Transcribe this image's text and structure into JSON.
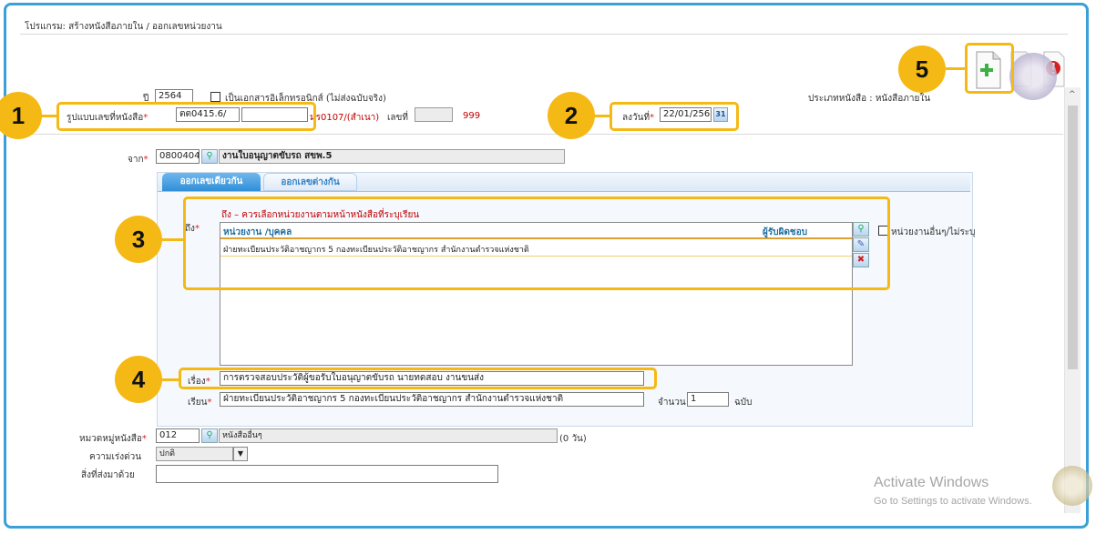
{
  "breadcrumb": "โปรแกรม: สร้างหนังสือภายใน / ออกเลขหน่วยงาน",
  "doc_type": "ประเภทหนังสือ : หนังสือภายใน",
  "year_label": "ปี",
  "year_value": "2564",
  "electronic_label": "เป็นเอกสารอิเล็กทรอนิกส์ (ไม่ส่งฉบับจริง)",
  "format_label": "รูปแบบเลขที่หนังสือ",
  "format_prefix": "ตต0415.6/",
  "format_suffix": "มร0107/(สำเนา)",
  "number_label": "เลขที่",
  "number_value": "999",
  "date_label": "ลงวันที่",
  "date_value": "22/01/256",
  "calendar_label": "31",
  "from_label": "จาก",
  "from_code": "0800404",
  "from_name": "งานใบอนุญาตขับรถ สขพ.5",
  "tabs": [
    "ออกเลขเดียวกัน",
    "ออกเลขต่างกัน"
  ],
  "to_label": "ถึง",
  "to_hint": "ถึง – ควรเลือกหน่วยงานตามหน้าหนังสือที่ระบุเรียน",
  "to_table": {
    "headers": [
      "หน่วยงาน /บุคคล",
      "ผู้รับผิดชอบ"
    ],
    "rows": [
      [
        "ฝ่ายทะเบียนประวัติอาชญากร 5 กองทะเบียนประวัติอาชญากร สำนักงานตำรวจแห่งชาติ",
        ""
      ]
    ]
  },
  "other_units_label": "หน่วยงานอื่นๆ/ไม่ระบุ",
  "subject_label": "เรื่อง",
  "subject_value": "การตรวจสอบประวัติผู้ขอรับใบอนุญาตขับรถ นายทดสอบ งานขนส่ง",
  "attention_label": "เรียน",
  "attention_value": "ฝ่ายทะเบียนประวัติอาชญากร 5 กองทะเบียนประวัติอาชญากร สำนักงานตำรวจแห่งชาติ",
  "copies_label": "จำนวน",
  "copies_value": "1",
  "copies_unit": "ฉบับ",
  "category_label": "หมวดหมู่หนังสือ",
  "category_code": "012",
  "category_name": "หนังสืออื่นๆ",
  "category_days": "(0 วัน)",
  "urgency_label": "ความเร่งด่วน",
  "urgency_value": "ปกติ",
  "enclosure_label": "สิ่งที่ส่งมาด้วย",
  "badges": [
    "1",
    "2",
    "3",
    "4",
    "5"
  ],
  "watermark_title": "Activate Windows",
  "watermark_sub": "Go to Settings to activate Windows.",
  "colors": {
    "accent": "#3ba0d8",
    "highlight": "#f5b915",
    "required": "#e02020",
    "link": "#c00000"
  }
}
